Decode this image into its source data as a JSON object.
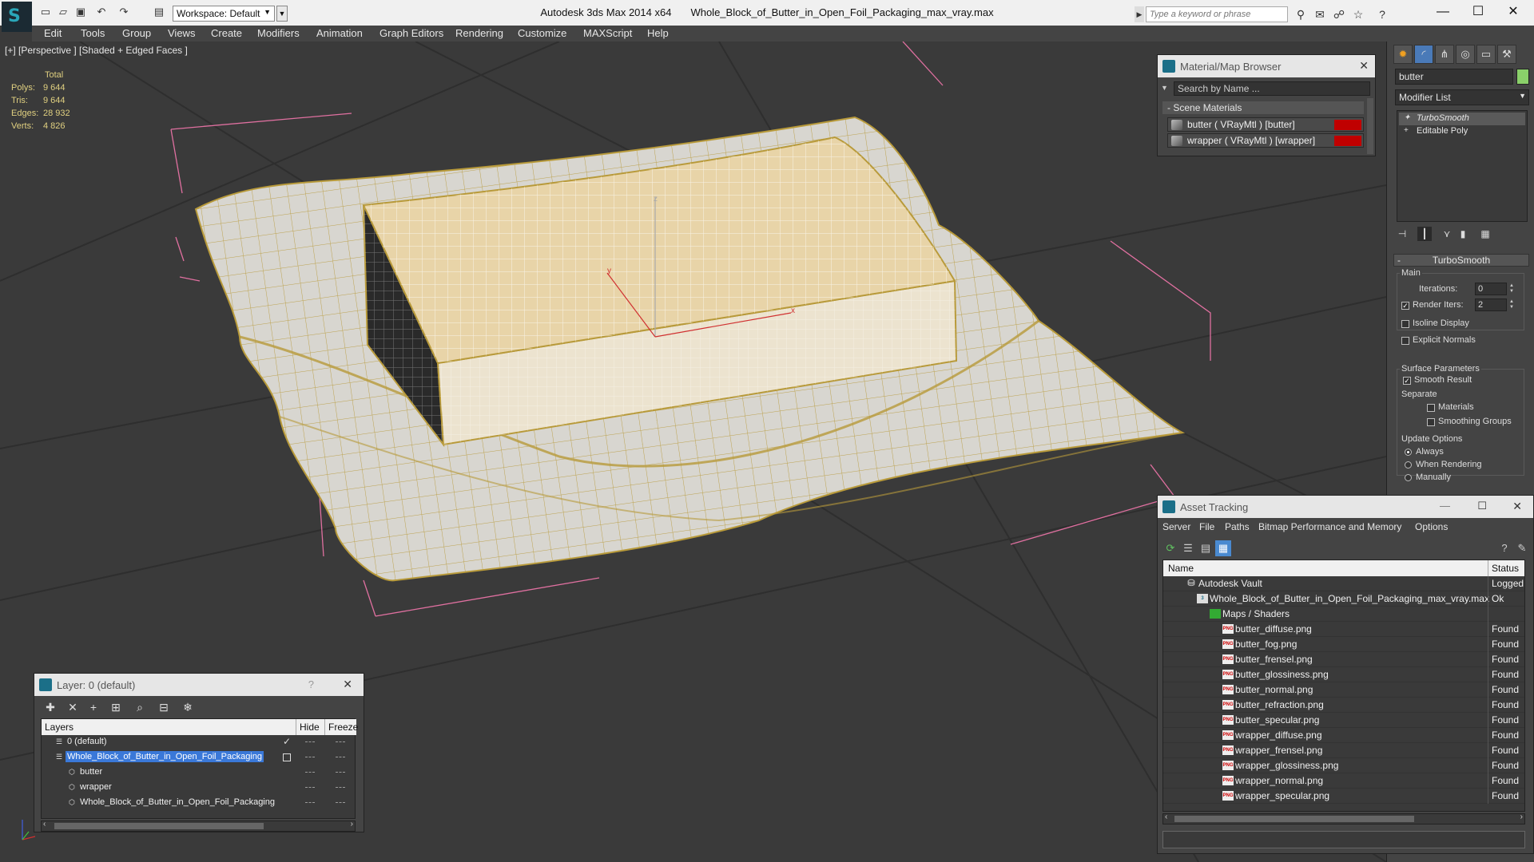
{
  "titlebar": {
    "app": "Autodesk 3ds Max  2014 x64",
    "file": "Whole_Block_of_Butter_in_Open_Foil_Packaging_max_vray.max",
    "workspace": "Workspace: Default",
    "keyword_placeholder": "Type a keyword or phrase"
  },
  "menu": [
    "Edit",
    "Tools",
    "Group",
    "Views",
    "Create",
    "Modifiers",
    "Animation",
    "Graph Editors",
    "Rendering",
    "Customize",
    "MAXScript",
    "Help"
  ],
  "viewport": {
    "label": "[+] [Perspective ] [Shaded + Edged Faces ]",
    "stats": {
      "header": "Total",
      "rows": [
        {
          "label": "Polys:",
          "value": "9 644"
        },
        {
          "label": "Tris:",
          "value": "9 644"
        },
        {
          "label": "Edges:",
          "value": "28 932"
        },
        {
          "label": "Verts:",
          "value": "4 826"
        }
      ]
    },
    "gizmo_labels": {
      "x": "x",
      "y": "y",
      "z": "z"
    }
  },
  "material_browser": {
    "title": "Material/Map Browser",
    "search_placeholder": "Search by Name ...",
    "section": "Scene Materials",
    "items": [
      "butter  ( VRayMtl ) [butter]",
      "wrapper  ( VRayMtl ) [wrapper]"
    ]
  },
  "command_panel": {
    "object_name": "butter",
    "object_color": "#8ad06a",
    "modifier_list": "Modifier List",
    "stack": [
      "TurboSmooth",
      "Editable Poly"
    ],
    "rollout": "TurboSmooth",
    "main_label": "Main",
    "iterations_label": "Iterations:",
    "iterations_value": "0",
    "render_iters_label": "Render Iters:",
    "render_iters_value": "2",
    "isoline": "Isoline Display",
    "explicit_normals": "Explicit Normals",
    "surface_params": "Surface Parameters",
    "smooth_result": "Smooth Result",
    "separate": "Separate",
    "materials": "Materials",
    "smoothing_groups": "Smoothing Groups",
    "update_options": "Update Options",
    "always": "Always",
    "when_rendering": "When Rendering",
    "manually": "Manually"
  },
  "asset_tracking": {
    "title": "Asset Tracking",
    "menu": [
      "Server",
      "File",
      "Paths",
      "Bitmap Performance and Memory",
      "Options"
    ],
    "col_name": "Name",
    "col_status": "Status",
    "rows": [
      {
        "name": "Autodesk Vault",
        "status": "Logged C",
        "level": 0,
        "kind": "vault"
      },
      {
        "name": "Whole_Block_of_Butter_in_Open_Foil_Packaging_max_vray.max",
        "status": "Ok",
        "level": 1,
        "kind": "max"
      },
      {
        "name": "Maps / Shaders",
        "status": "",
        "level": 2,
        "kind": "maps"
      },
      {
        "name": "butter_diffuse.png",
        "status": "Found",
        "level": 3,
        "kind": "png"
      },
      {
        "name": "butter_fog.png",
        "status": "Found",
        "level": 3,
        "kind": "png"
      },
      {
        "name": "butter_frensel.png",
        "status": "Found",
        "level": 3,
        "kind": "png"
      },
      {
        "name": "butter_glossiness.png",
        "status": "Found",
        "level": 3,
        "kind": "png"
      },
      {
        "name": "butter_normal.png",
        "status": "Found",
        "level": 3,
        "kind": "png"
      },
      {
        "name": "butter_refraction.png",
        "status": "Found",
        "level": 3,
        "kind": "png"
      },
      {
        "name": "butter_specular.png",
        "status": "Found",
        "level": 3,
        "kind": "png"
      },
      {
        "name": "wrapper_diffuse.png",
        "status": "Found",
        "level": 3,
        "kind": "png"
      },
      {
        "name": "wrapper_frensel.png",
        "status": "Found",
        "level": 3,
        "kind": "png"
      },
      {
        "name": "wrapper_glossiness.png",
        "status": "Found",
        "level": 3,
        "kind": "png"
      },
      {
        "name": "wrapper_normal.png",
        "status": "Found",
        "level": 3,
        "kind": "png"
      },
      {
        "name": "wrapper_specular.png",
        "status": "Found",
        "level": 3,
        "kind": "png"
      }
    ]
  },
  "layer_window": {
    "title": "Layer: 0 (default)",
    "help": "?",
    "col_layers": "Layers",
    "col_hide": "Hide",
    "col_freeze": "Freeze",
    "rows": [
      {
        "name": "0 (default)",
        "level": 0,
        "selected": false,
        "current": true
      },
      {
        "name": "Whole_Block_of_Butter_in_Open_Foil_Packaging",
        "level": 0,
        "selected": true,
        "current": false
      },
      {
        "name": "butter",
        "level": 1,
        "selected": false,
        "current": false
      },
      {
        "name": "wrapper",
        "level": 1,
        "selected": false,
        "current": false
      },
      {
        "name": "Whole_Block_of_Butter_in_Open_Foil_Packaging",
        "level": 1,
        "selected": false,
        "current": false
      }
    ]
  },
  "colors": {
    "accent": "#3a78d8",
    "wire": "#c8a83c",
    "butter": "#e8d4a8",
    "material_swatch": "#c00000"
  }
}
